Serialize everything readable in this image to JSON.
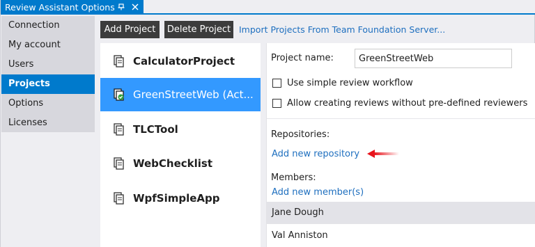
{
  "window": {
    "title": "Review Assistant Options",
    "pin_glyph": "⊓",
    "close_glyph": "✕"
  },
  "nav": {
    "items": [
      {
        "label": "Connection",
        "active": false
      },
      {
        "label": "My account",
        "active": false
      },
      {
        "label": "Users",
        "active": false
      },
      {
        "label": "Projects",
        "active": true
      },
      {
        "label": "Options",
        "active": false
      },
      {
        "label": "Licenses",
        "active": false
      }
    ]
  },
  "toolbar": {
    "add_label": "Add Project",
    "delete_label": "Delete Project",
    "import_link": "Import Projects From Team Foundation Server..."
  },
  "projects": [
    {
      "name": "CalculatorProject",
      "selected": false
    },
    {
      "name": "GreenStreetWeb (Act...",
      "selected": true
    },
    {
      "name": "TLCTool",
      "selected": false
    },
    {
      "name": "WebChecklist",
      "selected": false
    },
    {
      "name": "WpfSimpleApp",
      "selected": false
    }
  ],
  "details": {
    "project_name_label": "Project name:",
    "project_name_value": "GreenStreetWeb",
    "simple_workflow_label": "Use simple review workflow",
    "allow_reviews_label": "Allow creating reviews without pre-defined reviewers",
    "repositories_heading": "Repositories:",
    "add_repository_link": "Add new repository",
    "members_heading": "Members:",
    "add_member_link": "Add new member(s)",
    "members": [
      "Jane Dough",
      "Val Anniston"
    ]
  },
  "colors": {
    "accent": "#007acc",
    "selection": "#3399ff",
    "link": "#1e6fbf",
    "arrow": "#e8141c"
  }
}
